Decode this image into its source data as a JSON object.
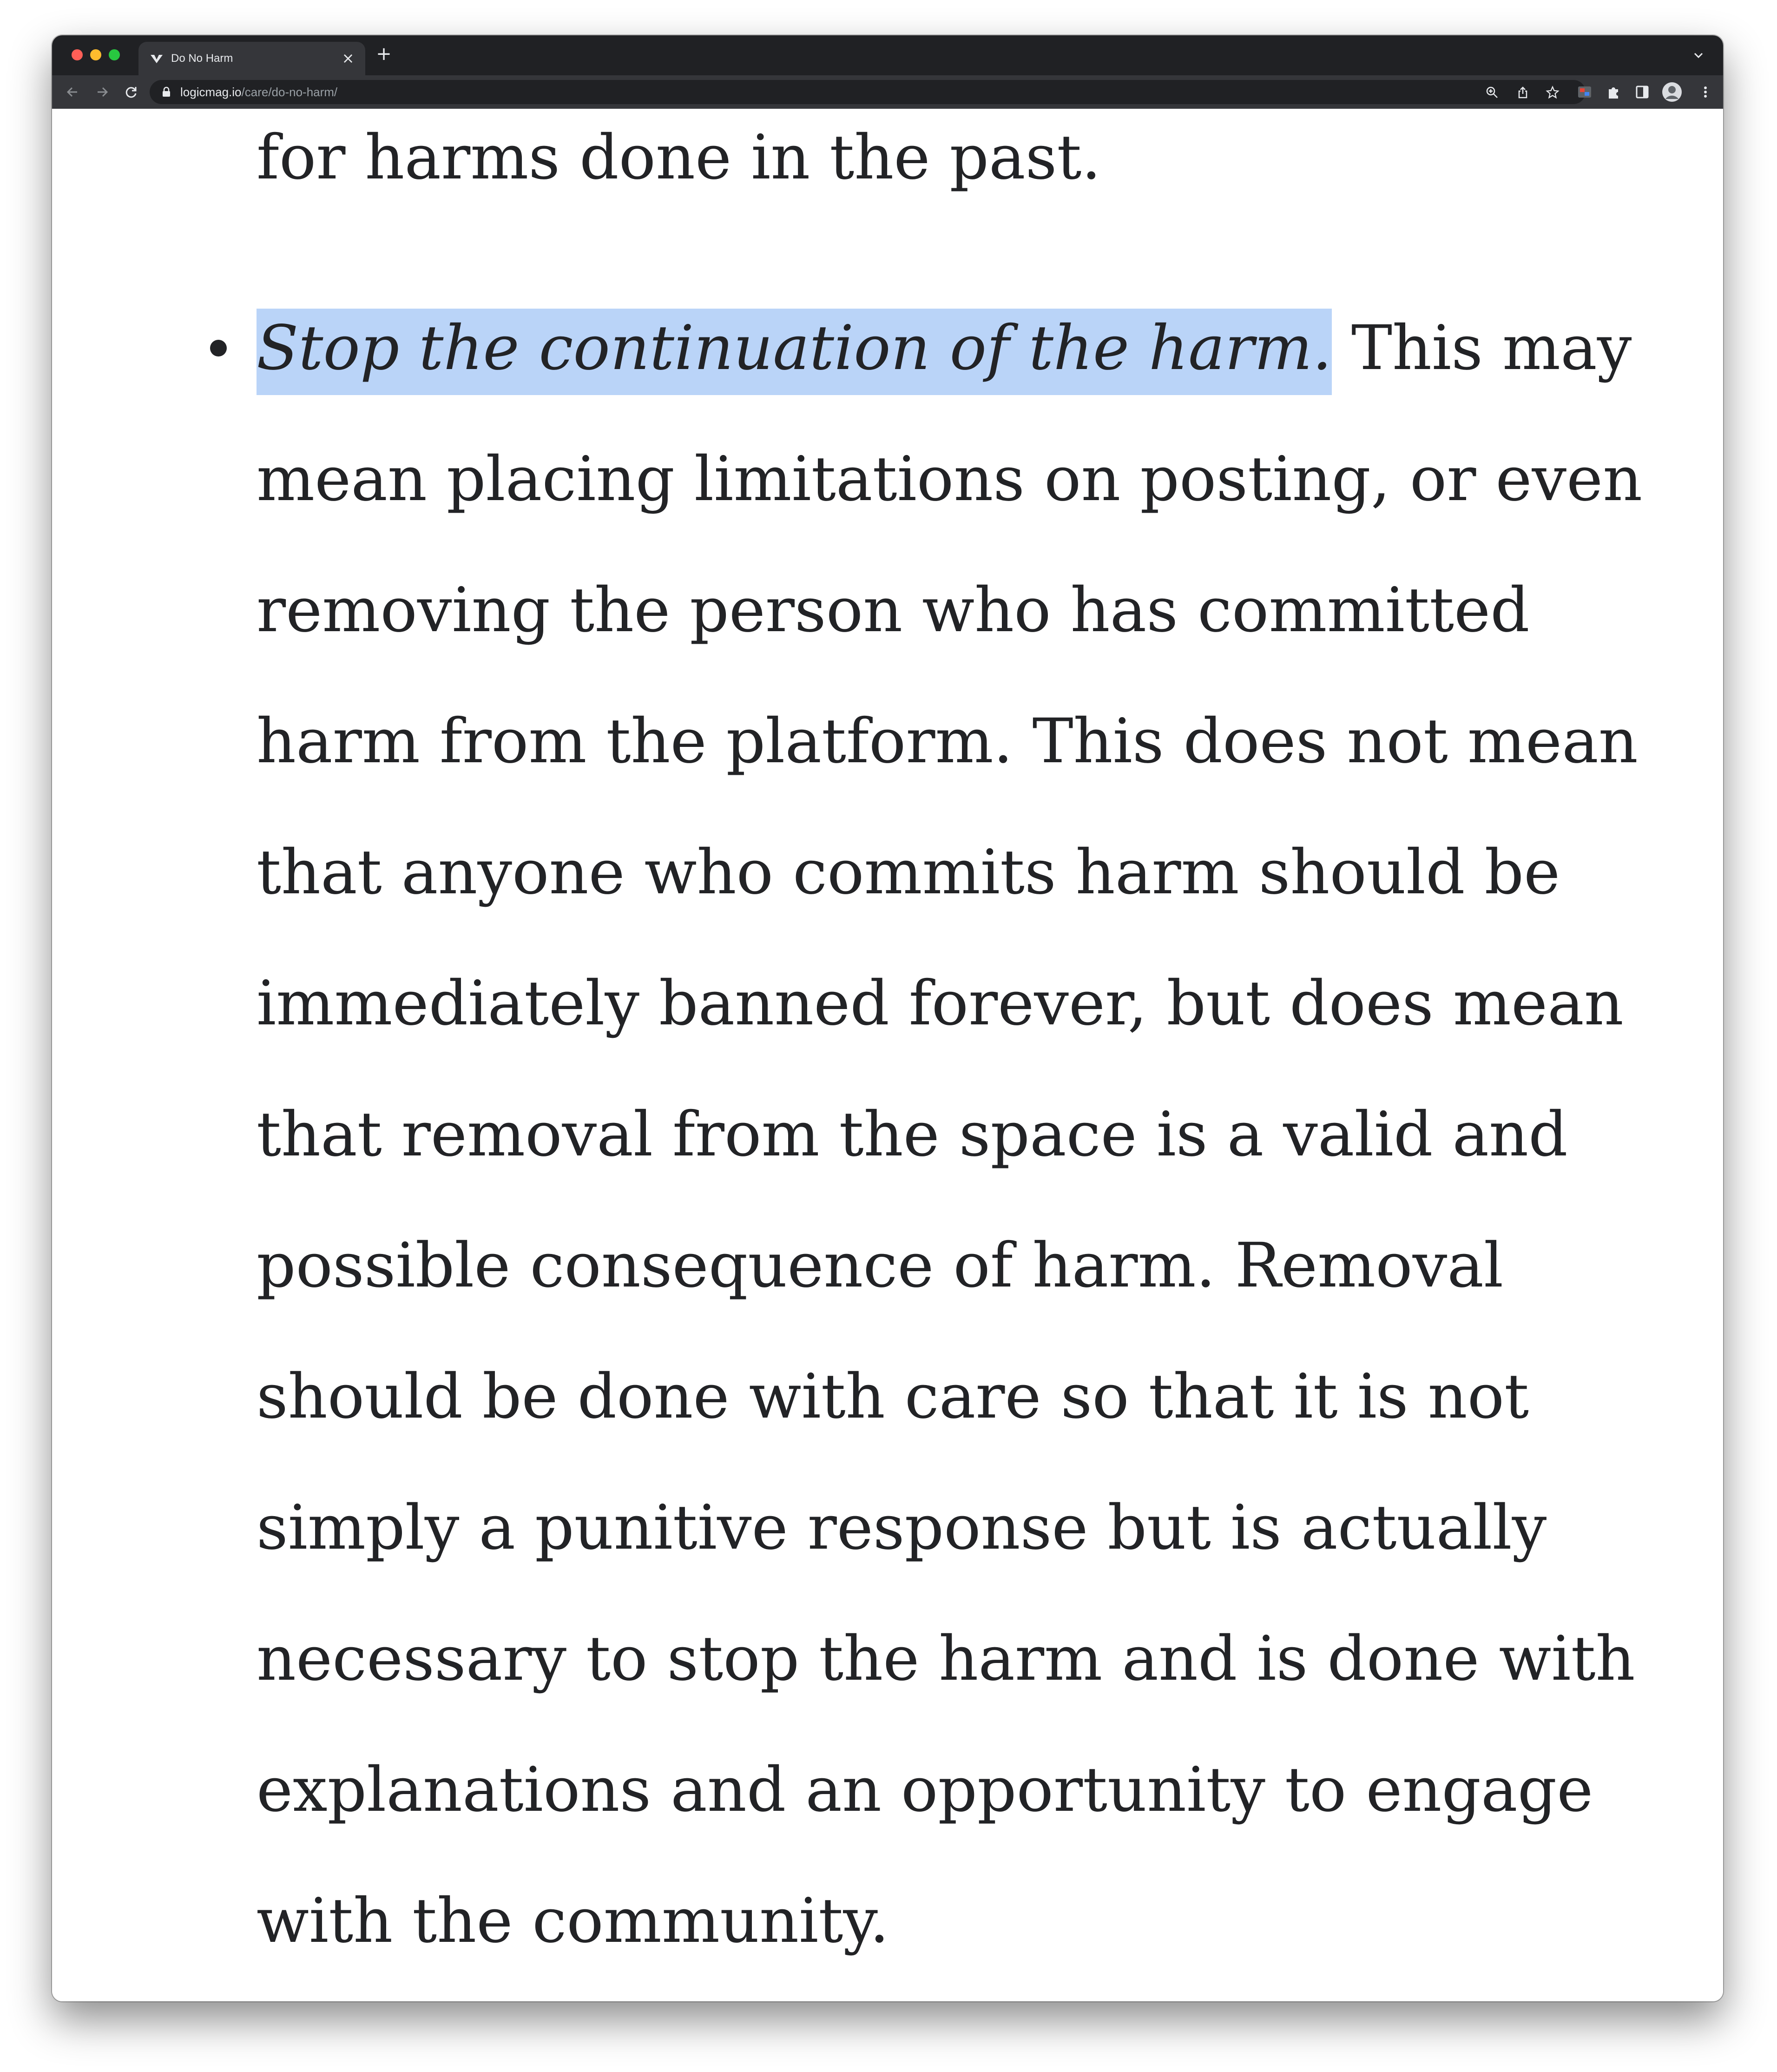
{
  "browser": {
    "tab_title": "Do No Harm",
    "tab_close": "×",
    "new_tab": "+",
    "url_host": "logicmag.io",
    "url_path": "/care/do-no-harm/"
  },
  "article": {
    "previous_line": "for harms done in the past.",
    "bullet_emphasis": "Stop the continuation of the harm.",
    "bullet_text": " This may mean placing limitations on posting, or even removing the person who has committed harm from the platform. This does not mean that anyone who commits harm should be immediately banned forever, but does mean that removal from the space is a valid and possible consequence of harm. Removal should be done with care so that it is not simply a punitive response but is actually necessary to stop the harm and is done with explanations and an opportunity to engage with the community."
  },
  "colors": {
    "chrome_dark": "#202124",
    "chrome_toolbar": "#35363a",
    "selection": "#bad4f8",
    "text": "#222326"
  },
  "icons": {
    "favicon": "logic-mag-icon",
    "back": "back-arrow-icon",
    "forward": "forward-arrow-icon",
    "reload": "reload-icon",
    "lock": "lock-icon",
    "zoom": "zoom-icon",
    "share": "share-icon",
    "bookmark": "star-icon",
    "extension": "extension-icon",
    "puzzle": "puzzle-icon",
    "sidepanel": "side-panel-icon",
    "profile": "avatar",
    "menu": "kebab-menu-icon",
    "tab_search": "chevron-down-icon"
  }
}
